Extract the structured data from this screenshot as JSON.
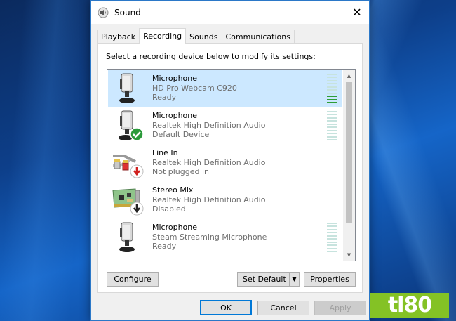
{
  "window": {
    "title": "Sound",
    "close": "✕"
  },
  "tabs": [
    {
      "label": "Playback",
      "active": false
    },
    {
      "label": "Recording",
      "active": true
    },
    {
      "label": "Sounds",
      "active": false
    },
    {
      "label": "Communications",
      "active": false
    }
  ],
  "instruction": "Select a recording device below to modify its settings:",
  "devices": [
    {
      "name": "Microphone",
      "description": "HD Pro Webcam C920",
      "status": "Ready",
      "icon": "microphone-icon",
      "badge": null,
      "meter_level": 0.3
    },
    {
      "name": "Microphone",
      "description": "Realtek High Definition Audio",
      "status": "Default Device",
      "icon": "microphone-icon",
      "badge": "green-check-badge",
      "meter_level": 0
    },
    {
      "name": "Line In",
      "description": "Realtek High Definition Audio",
      "status": "Not plugged in",
      "icon": "line-in-cable-icon",
      "badge": "red-down-arrow-badge",
      "meter_level": null
    },
    {
      "name": "Stereo Mix",
      "description": "Realtek High Definition Audio",
      "status": "Disabled",
      "icon": "sound-card-icon",
      "badge": "black-down-arrow-badge",
      "meter_level": null
    },
    {
      "name": "Microphone",
      "description": "Steam Streaming Microphone",
      "status": "Ready",
      "icon": "microphone-icon",
      "badge": null,
      "meter_level": 0
    }
  ],
  "buttons": {
    "configure": "Configure",
    "set_default": "Set Default",
    "properties": "Properties",
    "ok": "OK",
    "cancel": "Cancel",
    "apply": "Apply"
  },
  "watermark": "tl80",
  "colors": {
    "selected_row": "#cce8ff",
    "meter_on": "#2e9d36",
    "meter_off": "#c7e3de",
    "accent": "#0078d7",
    "watermark_bg": "#84c225"
  }
}
